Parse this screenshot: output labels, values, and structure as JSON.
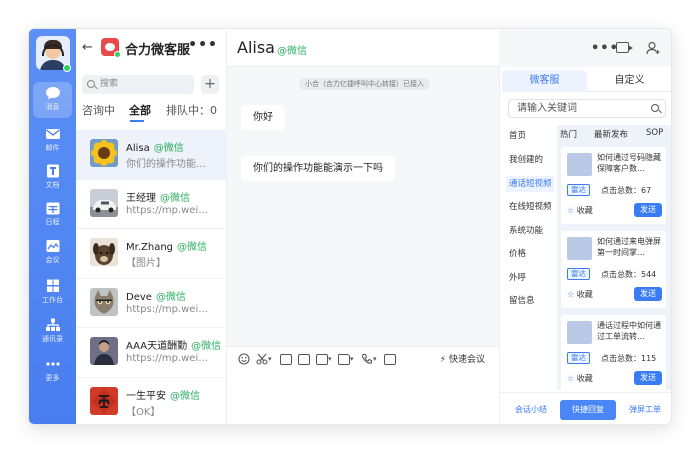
{
  "rail": {
    "items": [
      {
        "label": "消息",
        "icon": "chat-bubble-icon"
      },
      {
        "label": "邮件",
        "icon": "mail-icon"
      },
      {
        "label": "文档",
        "icon": "document-icon"
      },
      {
        "label": "日程",
        "icon": "calendar-icon"
      },
      {
        "label": "会议",
        "icon": "meeting-icon"
      },
      {
        "label": "工作台",
        "icon": "workbench-grid-icon"
      },
      {
        "label": "通讯录",
        "icon": "org-chart-icon"
      },
      {
        "label": "更多",
        "icon": "more-dots-icon"
      }
    ],
    "active_index": 0
  },
  "contacts": {
    "app_title": "合力微客服",
    "search_placeholder": "搜索",
    "tabs": {
      "in_consult": "咨询中",
      "all": "全部",
      "queue": "排队中：0"
    },
    "list": [
      {
        "name": "Alisa",
        "channel": "@微信",
        "message": "你们的操作功能…",
        "avatar": "sunflower-avatar"
      },
      {
        "name": "王经理",
        "channel": "@微信",
        "message": "https://mp.wei…",
        "avatar": "car-avatar"
      },
      {
        "name": "Mr.Zhang",
        "channel": "@微信",
        "message": "【图片】",
        "avatar": "dog-avatar"
      },
      {
        "name": "Deve",
        "channel": "@微信",
        "message": "https://mp.wei…",
        "avatar": "cat-avatar"
      },
      {
        "name": "AAA天道酬勤",
        "channel": "@微信",
        "message": "https://mp.wei…",
        "avatar": "person-avatar"
      },
      {
        "name": "一生平安",
        "channel": "@微信",
        "message": "【OK】",
        "avatar": "fu-avatar"
      }
    ]
  },
  "chat": {
    "name": "Alisa",
    "channel": "@微信",
    "notice": "小合（合力亿捷呼叫中心转接）已接入",
    "messages": [
      "你好",
      "你们的操作功能能演示一下吗"
    ],
    "fast_meeting": "快速会议"
  },
  "side": {
    "tabs": [
      "微客服",
      "自定义"
    ],
    "active_tab": 0,
    "search_placeholder": "请输入关键词",
    "categories": [
      "首页",
      "我创建的",
      "通话短视频",
      "在线短视频",
      "系统功能",
      "价格",
      "外呼",
      "留信息"
    ],
    "active_category": 2,
    "content_tabs": [
      "热门",
      "最新发布",
      "SOP"
    ],
    "cards": [
      {
        "title": "如何通过号码隐藏保障客户数…",
        "tag": "雷达",
        "views": "点击总数：67",
        "fav": "收藏",
        "send": "发送"
      },
      {
        "title": "如何通过来电弹屏第一时间掌…",
        "tag": "雷达",
        "views": "点击总数：544",
        "fav": "收藏",
        "send": "发送"
      },
      {
        "title": "通话过程中如何通过工单流转…",
        "tag": "雷达",
        "views": "点击总数：115",
        "fav": "收藏",
        "send": "发送"
      }
    ],
    "bottom": [
      "会话小结",
      "快捷回复",
      "弹屏工单"
    ],
    "bottom_active": 1
  }
}
